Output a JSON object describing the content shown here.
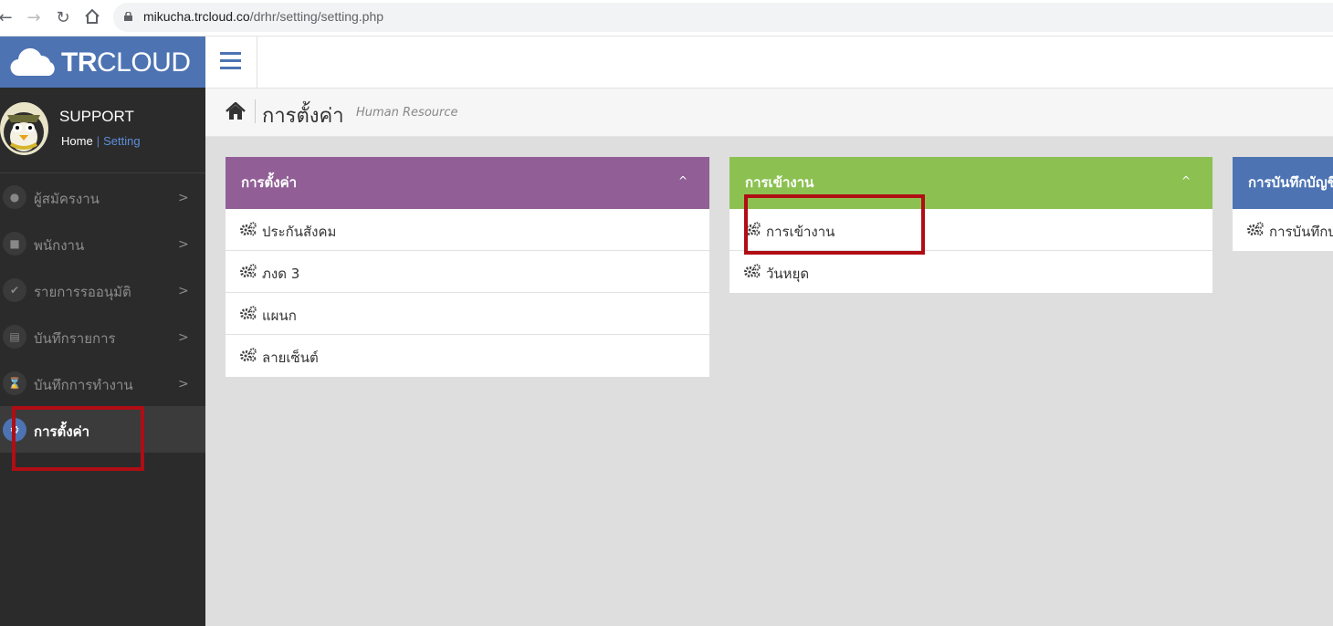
{
  "browser": {
    "url_domain": "mikucha.trcloud.co",
    "url_path": "/drhr/setting/setting.php"
  },
  "sidebar": {
    "logo_bold": "TR",
    "logo_light": "CLOUD",
    "user_name": "SUPPORT",
    "user_home": "Home",
    "user_sep": "|",
    "user_setting": "Setting",
    "items": [
      {
        "label": "ผู้สมัครงาน",
        "icon": "user-icon"
      },
      {
        "label": "พนักงาน",
        "icon": "employee-icon"
      },
      {
        "label": "รายการรออนุมัติ",
        "icon": "check-icon"
      },
      {
        "label": "บันทึกรายการ",
        "icon": "document-icon"
      },
      {
        "label": "บันทึกการทำงาน",
        "icon": "hourglass-icon"
      },
      {
        "label": "การตั้งค่า",
        "icon": "gear-icon"
      }
    ]
  },
  "page": {
    "title": "การตั้งค่า",
    "subtitle": "Human Resource"
  },
  "panels": [
    {
      "title": "การตั้งค่า",
      "color": "#915f96",
      "rows": [
        "ประกันสังคม",
        "ภงด 3",
        "แผนก",
        "ลายเซ็นต์"
      ]
    },
    {
      "title": "การเข้างาน",
      "color": "#8cc152",
      "rows": [
        "การเข้างาน",
        "วันหยุด"
      ]
    },
    {
      "title": "การบันทึกบัญชี",
      "color": "#4d73b3",
      "rows": [
        "การบันทึกบ"
      ]
    }
  ],
  "colors": {
    "brand_blue": "#4d73b3",
    "sidebar_bg": "#2b2b2b",
    "highlight_red": "#b00d14"
  }
}
